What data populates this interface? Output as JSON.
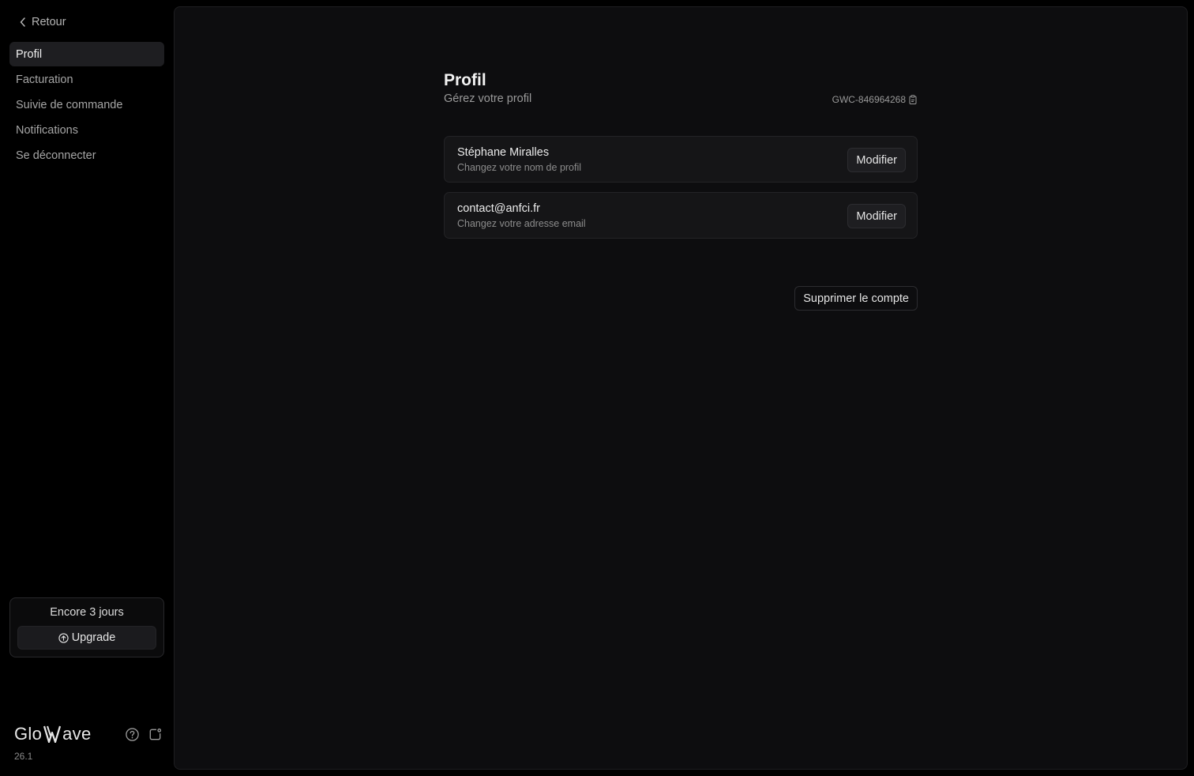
{
  "sidebar": {
    "back_label": "Retour",
    "nav": [
      {
        "label": "Profil",
        "active": true
      },
      {
        "label": "Facturation",
        "active": false
      },
      {
        "label": "Suivie de commande",
        "active": false
      },
      {
        "label": "Notifications",
        "active": false
      },
      {
        "label": "Se déconnecter",
        "active": false
      }
    ],
    "trial": {
      "text": "Encore 3 jours",
      "upgrade_label": "Upgrade",
      "upgrade_icon": "arrow-up-circle-icon"
    },
    "brand": {
      "name_prefix": "Glo",
      "name_suffix": "ave",
      "version": "26.1"
    },
    "footer_icons": [
      "help-circle-icon",
      "share-icon"
    ]
  },
  "main": {
    "title": "Profil",
    "subtitle": "Gérez votre profil",
    "account_id": "GWC-846964268",
    "account_id_icon": "copy-icon",
    "cards": [
      {
        "title": "Stéphane Miralles",
        "description": "Changez votre nom de profil",
        "button": "Modifier"
      },
      {
        "title": "contact@anfci.fr",
        "description": "Changez votre adresse email",
        "button": "Modifier"
      }
    ],
    "delete_label": "Supprimer le compte"
  },
  "colors": {
    "background": "#000000",
    "panel": "#0d0d0f",
    "card": "#151517",
    "active_nav": "#1e1e21",
    "text_primary": "#f0f0f0",
    "text_muted": "#9a9a9a"
  }
}
